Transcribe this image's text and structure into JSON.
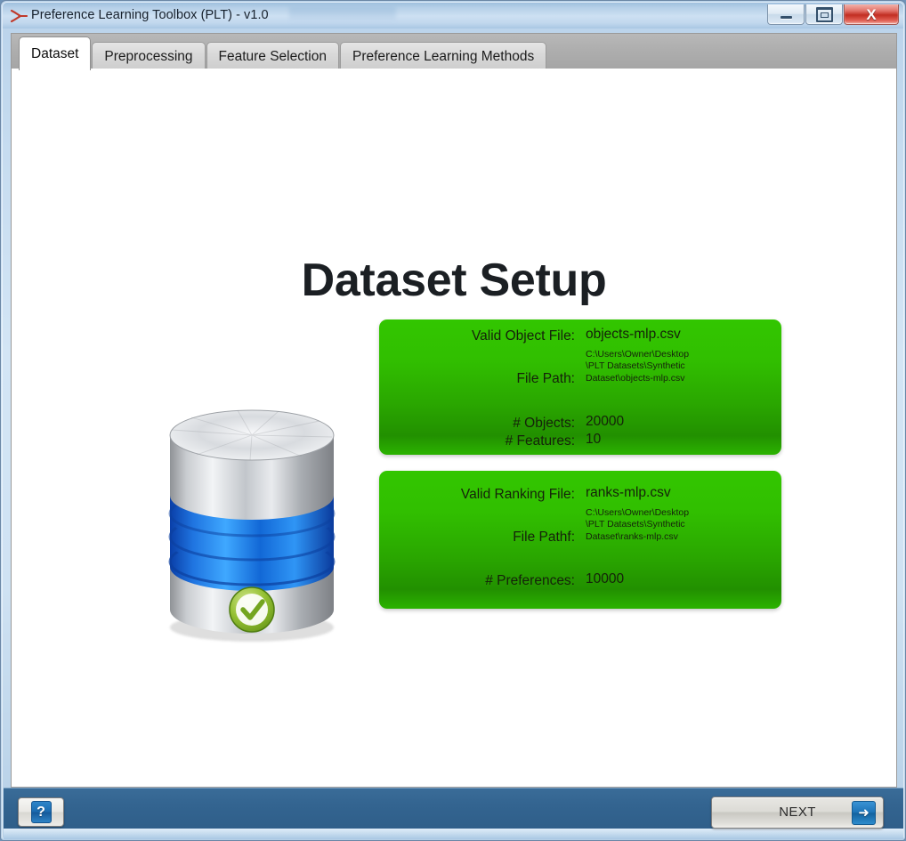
{
  "window": {
    "title": "Preference Learning Toolbox (PLT) - v1.0",
    "app_icon": "preference-fork-icon",
    "controls": {
      "minimize": "minimize-icon",
      "maximize": "maximize-icon",
      "close": "X"
    }
  },
  "tabs": [
    {
      "label": "Dataset",
      "active": true
    },
    {
      "label": "Preprocessing",
      "active": false
    },
    {
      "label": "Feature Selection",
      "active": false
    },
    {
      "label": "Preference Learning Methods",
      "active": false
    }
  ],
  "main": {
    "page_title": "Dataset Setup",
    "database_icon": "database-check-icon",
    "panels": [
      {
        "id": "object-file-panel",
        "rows": [
          {
            "label": "Valid Object File:",
            "value": "objects-mlp.csv",
            "type": "text"
          },
          {
            "label": "File Path:",
            "value": "C:\\Users\\Owner\\Desktop\\PLT Datasets\\Synthetic Dataset\\objects-mlp.csv",
            "type": "path"
          },
          {
            "label": "# Objects:",
            "value": "20000",
            "type": "text"
          },
          {
            "label": "# Features:",
            "value": "10",
            "type": "text"
          }
        ]
      },
      {
        "id": "ranking-file-panel",
        "rows": [
          {
            "label": "Valid Ranking File:",
            "value": "ranks-mlp.csv",
            "type": "text"
          },
          {
            "label": "File Pathf:",
            "value": "C:\\Users\\Owner\\Desktop\\PLT Datasets\\Synthetic Dataset\\ranks-mlp.csv",
            "type": "path"
          },
          {
            "label": "# Preferences:",
            "value": "10000",
            "type": "text"
          }
        ]
      }
    ]
  },
  "footer": {
    "help_label": "?",
    "next_label": "NEXT",
    "next_arrow": "arrow-right-icon"
  },
  "colors": {
    "panel_green_top": "#32c600",
    "panel_green_bottom": "#229000",
    "footer_blue": "#336490",
    "titlebar_blue": "#c0d8ef",
    "close_red": "#c22e22"
  }
}
